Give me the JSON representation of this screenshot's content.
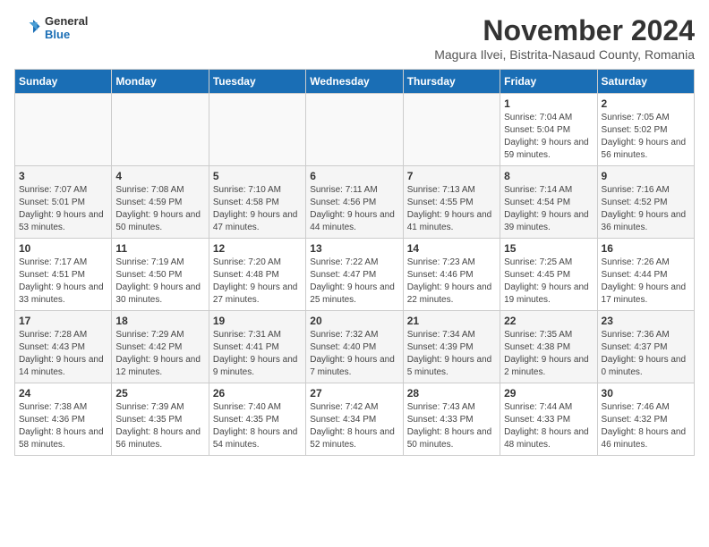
{
  "logo": {
    "line1": "General",
    "line2": "Blue"
  },
  "title": "November 2024",
  "subtitle": "Magura Ilvei, Bistrita-Nasaud County, Romania",
  "weekdays": [
    "Sunday",
    "Monday",
    "Tuesday",
    "Wednesday",
    "Thursday",
    "Friday",
    "Saturday"
  ],
  "weeks": [
    [
      {
        "day": "",
        "info": ""
      },
      {
        "day": "",
        "info": ""
      },
      {
        "day": "",
        "info": ""
      },
      {
        "day": "",
        "info": ""
      },
      {
        "day": "",
        "info": ""
      },
      {
        "day": "1",
        "info": "Sunrise: 7:04 AM\nSunset: 5:04 PM\nDaylight: 9 hours and 59 minutes."
      },
      {
        "day": "2",
        "info": "Sunrise: 7:05 AM\nSunset: 5:02 PM\nDaylight: 9 hours and 56 minutes."
      }
    ],
    [
      {
        "day": "3",
        "info": "Sunrise: 7:07 AM\nSunset: 5:01 PM\nDaylight: 9 hours and 53 minutes."
      },
      {
        "day": "4",
        "info": "Sunrise: 7:08 AM\nSunset: 4:59 PM\nDaylight: 9 hours and 50 minutes."
      },
      {
        "day": "5",
        "info": "Sunrise: 7:10 AM\nSunset: 4:58 PM\nDaylight: 9 hours and 47 minutes."
      },
      {
        "day": "6",
        "info": "Sunrise: 7:11 AM\nSunset: 4:56 PM\nDaylight: 9 hours and 44 minutes."
      },
      {
        "day": "7",
        "info": "Sunrise: 7:13 AM\nSunset: 4:55 PM\nDaylight: 9 hours and 41 minutes."
      },
      {
        "day": "8",
        "info": "Sunrise: 7:14 AM\nSunset: 4:54 PM\nDaylight: 9 hours and 39 minutes."
      },
      {
        "day": "9",
        "info": "Sunrise: 7:16 AM\nSunset: 4:52 PM\nDaylight: 9 hours and 36 minutes."
      }
    ],
    [
      {
        "day": "10",
        "info": "Sunrise: 7:17 AM\nSunset: 4:51 PM\nDaylight: 9 hours and 33 minutes."
      },
      {
        "day": "11",
        "info": "Sunrise: 7:19 AM\nSunset: 4:50 PM\nDaylight: 9 hours and 30 minutes."
      },
      {
        "day": "12",
        "info": "Sunrise: 7:20 AM\nSunset: 4:48 PM\nDaylight: 9 hours and 27 minutes."
      },
      {
        "day": "13",
        "info": "Sunrise: 7:22 AM\nSunset: 4:47 PM\nDaylight: 9 hours and 25 minutes."
      },
      {
        "day": "14",
        "info": "Sunrise: 7:23 AM\nSunset: 4:46 PM\nDaylight: 9 hours and 22 minutes."
      },
      {
        "day": "15",
        "info": "Sunrise: 7:25 AM\nSunset: 4:45 PM\nDaylight: 9 hours and 19 minutes."
      },
      {
        "day": "16",
        "info": "Sunrise: 7:26 AM\nSunset: 4:44 PM\nDaylight: 9 hours and 17 minutes."
      }
    ],
    [
      {
        "day": "17",
        "info": "Sunrise: 7:28 AM\nSunset: 4:43 PM\nDaylight: 9 hours and 14 minutes."
      },
      {
        "day": "18",
        "info": "Sunrise: 7:29 AM\nSunset: 4:42 PM\nDaylight: 9 hours and 12 minutes."
      },
      {
        "day": "19",
        "info": "Sunrise: 7:31 AM\nSunset: 4:41 PM\nDaylight: 9 hours and 9 minutes."
      },
      {
        "day": "20",
        "info": "Sunrise: 7:32 AM\nSunset: 4:40 PM\nDaylight: 9 hours and 7 minutes."
      },
      {
        "day": "21",
        "info": "Sunrise: 7:34 AM\nSunset: 4:39 PM\nDaylight: 9 hours and 5 minutes."
      },
      {
        "day": "22",
        "info": "Sunrise: 7:35 AM\nSunset: 4:38 PM\nDaylight: 9 hours and 2 minutes."
      },
      {
        "day": "23",
        "info": "Sunrise: 7:36 AM\nSunset: 4:37 PM\nDaylight: 9 hours and 0 minutes."
      }
    ],
    [
      {
        "day": "24",
        "info": "Sunrise: 7:38 AM\nSunset: 4:36 PM\nDaylight: 8 hours and 58 minutes."
      },
      {
        "day": "25",
        "info": "Sunrise: 7:39 AM\nSunset: 4:35 PM\nDaylight: 8 hours and 56 minutes."
      },
      {
        "day": "26",
        "info": "Sunrise: 7:40 AM\nSunset: 4:35 PM\nDaylight: 8 hours and 54 minutes."
      },
      {
        "day": "27",
        "info": "Sunrise: 7:42 AM\nSunset: 4:34 PM\nDaylight: 8 hours and 52 minutes."
      },
      {
        "day": "28",
        "info": "Sunrise: 7:43 AM\nSunset: 4:33 PM\nDaylight: 8 hours and 50 minutes."
      },
      {
        "day": "29",
        "info": "Sunrise: 7:44 AM\nSunset: 4:33 PM\nDaylight: 8 hours and 48 minutes."
      },
      {
        "day": "30",
        "info": "Sunrise: 7:46 AM\nSunset: 4:32 PM\nDaylight: 8 hours and 46 minutes."
      }
    ]
  ]
}
